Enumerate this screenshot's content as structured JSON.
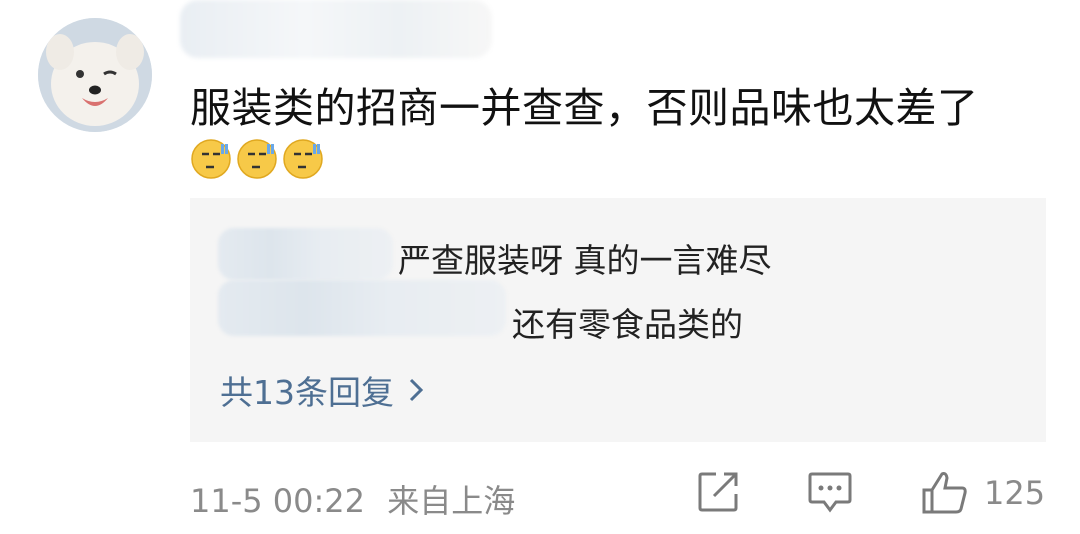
{
  "comment": {
    "text": "服装类的招商一并查查，否则品味也太差了",
    "emojis": [
      "sweat-smile-emoji",
      "sweat-smile-emoji",
      "sweat-smile-emoji"
    ]
  },
  "replies": [
    {
      "text": "严查服装呀 真的一言难尽"
    },
    {
      "text": "还有零食品类的"
    }
  ],
  "more_replies_label": "共13条回复",
  "footer": {
    "time": "11-5 00:22",
    "location": "来自上海",
    "likes": "125"
  },
  "colors": {
    "link": "#4e6f93",
    "reply_bg": "#f5f5f5",
    "meta_text": "#8a8a8a"
  },
  "icons": [
    "share-icon",
    "comment-icon",
    "thumbs-up-icon",
    "chevron-right-icon"
  ]
}
